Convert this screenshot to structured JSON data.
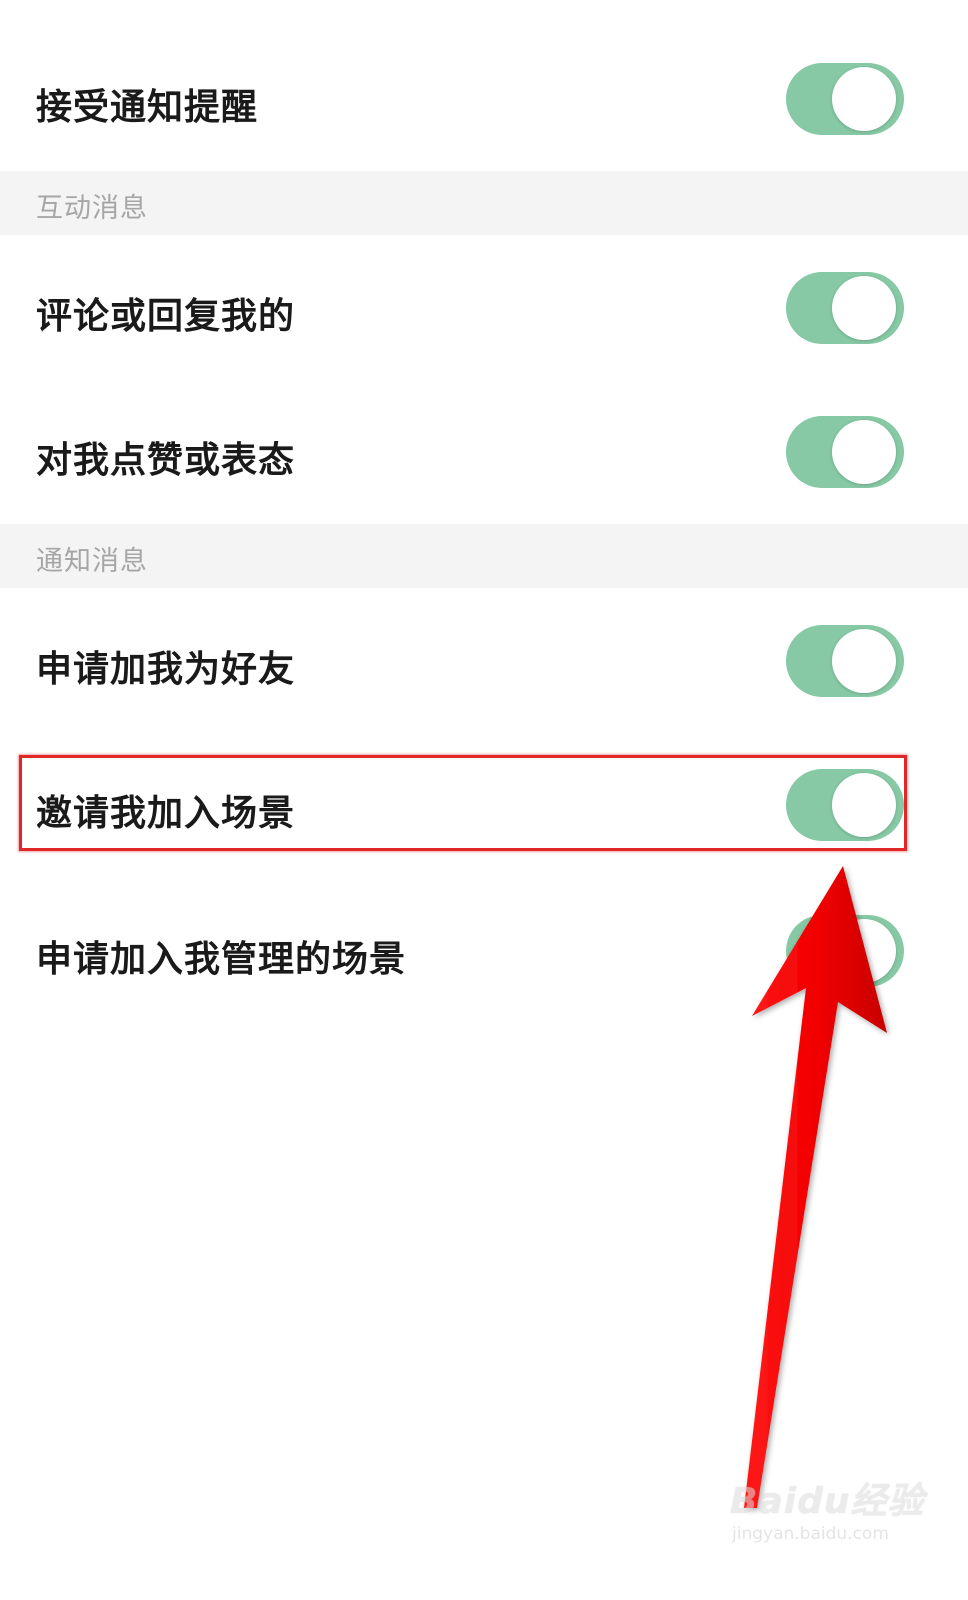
{
  "settings": {
    "master": {
      "label": "接受通知提醒",
      "on": true
    },
    "sections": [
      {
        "title": "互动消息",
        "items": [
          {
            "label": "评论或回复我的",
            "on": true
          },
          {
            "label": "对我点赞或表态",
            "on": true
          }
        ]
      },
      {
        "title": "通知消息",
        "items": [
          {
            "label": "申请加我为好友",
            "on": true
          },
          {
            "label": "邀请我加入场景",
            "on": true
          },
          {
            "label": "申请加入我管理的场景",
            "on": true
          }
        ]
      }
    ]
  },
  "colors": {
    "toggle_on": "#86c9a4",
    "highlight": "#e02828",
    "arrow": "#f20000"
  },
  "annotation": {
    "highlighted_item": "邀请我加入场景",
    "arrow_icon": "red-arrow-icon"
  },
  "watermark": {
    "logo": "Baidu经验",
    "url": "jingyan.baidu.com"
  }
}
